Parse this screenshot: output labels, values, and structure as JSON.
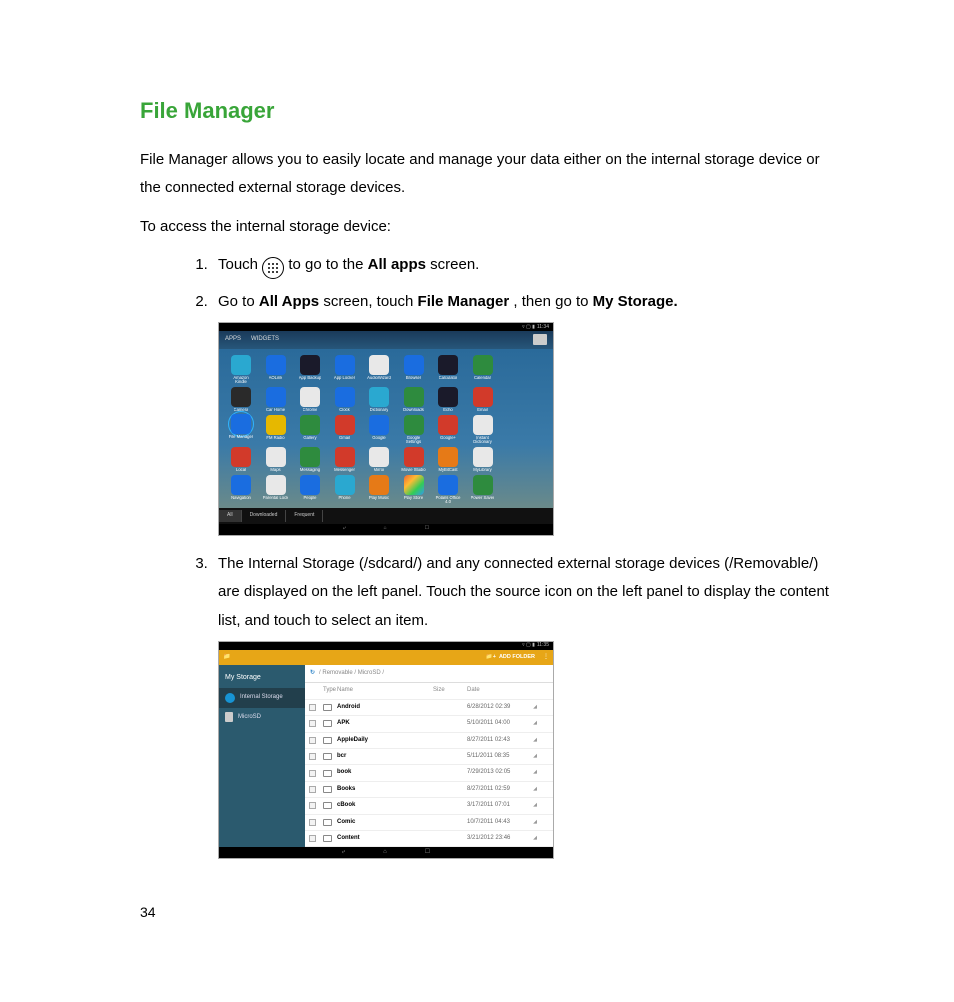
{
  "title": "File Manager",
  "intro": "File Manager allows you to easily locate and manage your data either on the internal storage device or the connected external storage devices.",
  "access_line": "To access the internal storage device:",
  "steps": {
    "s1a": "Touch ",
    "s1b": " to go to the ",
    "s1c": "All apps",
    "s1d": " screen.",
    "s2a": "Go to ",
    "s2b": "All Apps",
    "s2c": " screen, touch ",
    "s2d": "File Manager",
    "s2e": ", then go to ",
    "s2f": "My Storage.",
    "s3": "The Internal Storage (/sdcard/) and any connected external storage devices (/Removable/) are displayed on the left panel. Touch the source icon on the left panel to display the content list, and touch to select an item."
  },
  "page_number": "34",
  "shot1": {
    "time": "11:34",
    "tab_apps": "APPS",
    "tab_widgets": "WIDGETS",
    "filter_all": "All",
    "filter_downloaded": "Downloaded",
    "filter_frequent": "Frequent",
    "rows": [
      [
        {
          "l": "Amazon Kindle",
          "c": "ic-cyan"
        },
        {
          "l": "AOLink",
          "c": "ic-blue"
        },
        {
          "l": "App Backup",
          "c": "ic-dark"
        },
        {
          "l": "App Locker",
          "c": "ic-blue"
        },
        {
          "l": "AudioWizard",
          "c": "ic-white"
        },
        {
          "l": "Browser",
          "c": "ic-blue"
        },
        {
          "l": "Calculator",
          "c": "ic-dark"
        },
        {
          "l": "Calendar",
          "c": "ic-green"
        },
        {
          "l": "",
          "c": ""
        }
      ],
      [
        {
          "l": "Camera",
          "c": "ic-camera"
        },
        {
          "l": "Car Home",
          "c": "ic-blue"
        },
        {
          "l": "Chrome",
          "c": "ic-white"
        },
        {
          "l": "Clock",
          "c": "ic-blue"
        },
        {
          "l": "Dictionary",
          "c": "ic-cyan"
        },
        {
          "l": "Downloads",
          "c": "ic-green"
        },
        {
          "l": "Echo",
          "c": "ic-dark"
        },
        {
          "l": "Email",
          "c": "ic-red"
        },
        {
          "l": "",
          "c": ""
        }
      ],
      [
        {
          "l": "File Manager",
          "c": "ic-blue",
          "sel": true
        },
        {
          "l": "FM Radio",
          "c": "ic-yellow"
        },
        {
          "l": "Gallery",
          "c": "ic-green"
        },
        {
          "l": "Gmail",
          "c": "ic-red"
        },
        {
          "l": "Google",
          "c": "ic-blue"
        },
        {
          "l": "Google Settings",
          "c": "ic-green"
        },
        {
          "l": "Google+",
          "c": "ic-red"
        },
        {
          "l": "Instant Dictionary",
          "c": "ic-white"
        },
        {
          "l": "",
          "c": ""
        }
      ],
      [
        {
          "l": "Local",
          "c": "ic-red"
        },
        {
          "l": "Maps",
          "c": "ic-white"
        },
        {
          "l": "Messaging",
          "c": "ic-green"
        },
        {
          "l": "Messenger",
          "c": "ic-red"
        },
        {
          "l": "Mirror",
          "c": "ic-white"
        },
        {
          "l": "Movie Studio",
          "c": "ic-red"
        },
        {
          "l": "MyBitCast",
          "c": "ic-orange"
        },
        {
          "l": "MyLibrary",
          "c": "ic-white"
        },
        {
          "l": "",
          "c": ""
        }
      ],
      [
        {
          "l": "Navigation",
          "c": "ic-blue"
        },
        {
          "l": "Parental Lock",
          "c": "ic-white"
        },
        {
          "l": "People",
          "c": "ic-blue"
        },
        {
          "l": "Phone",
          "c": "ic-cyan"
        },
        {
          "l": "Play Music",
          "c": "ic-orange"
        },
        {
          "l": "Play Store",
          "c": "ic-play"
        },
        {
          "l": "Polaris Office 4.0",
          "c": "ic-blue"
        },
        {
          "l": "Power Saver",
          "c": "ic-green"
        },
        {
          "l": "",
          "c": ""
        }
      ]
    ]
  },
  "shot2": {
    "time": "11:35",
    "bar_icon_title": "",
    "add_folder": "ADD FOLDER",
    "side_title": "My Storage",
    "side_internal": "Internal Storage",
    "side_microsd": "MicroSD",
    "crumb": "/ Removable / MicroSD /",
    "head_type": "Type",
    "head_name": "Name",
    "head_size": "Size",
    "head_date": "Date",
    "rows": [
      {
        "name": "Android",
        "date": "6/28/2012 02:39"
      },
      {
        "name": "APK",
        "date": "5/10/2011 04:00"
      },
      {
        "name": "AppleDaily",
        "date": "8/27/2011 02:43"
      },
      {
        "name": "bcr",
        "date": "5/11/2011 08:35"
      },
      {
        "name": "book",
        "date": "7/29/2013 02:05"
      },
      {
        "name": "Books",
        "date": "8/27/2011 02:59"
      },
      {
        "name": "cBook",
        "date": "3/17/2011 07:01"
      },
      {
        "name": "Comic",
        "date": "10/7/2011 04:43"
      },
      {
        "name": "Content",
        "date": "3/21/2012 23:46"
      }
    ]
  }
}
